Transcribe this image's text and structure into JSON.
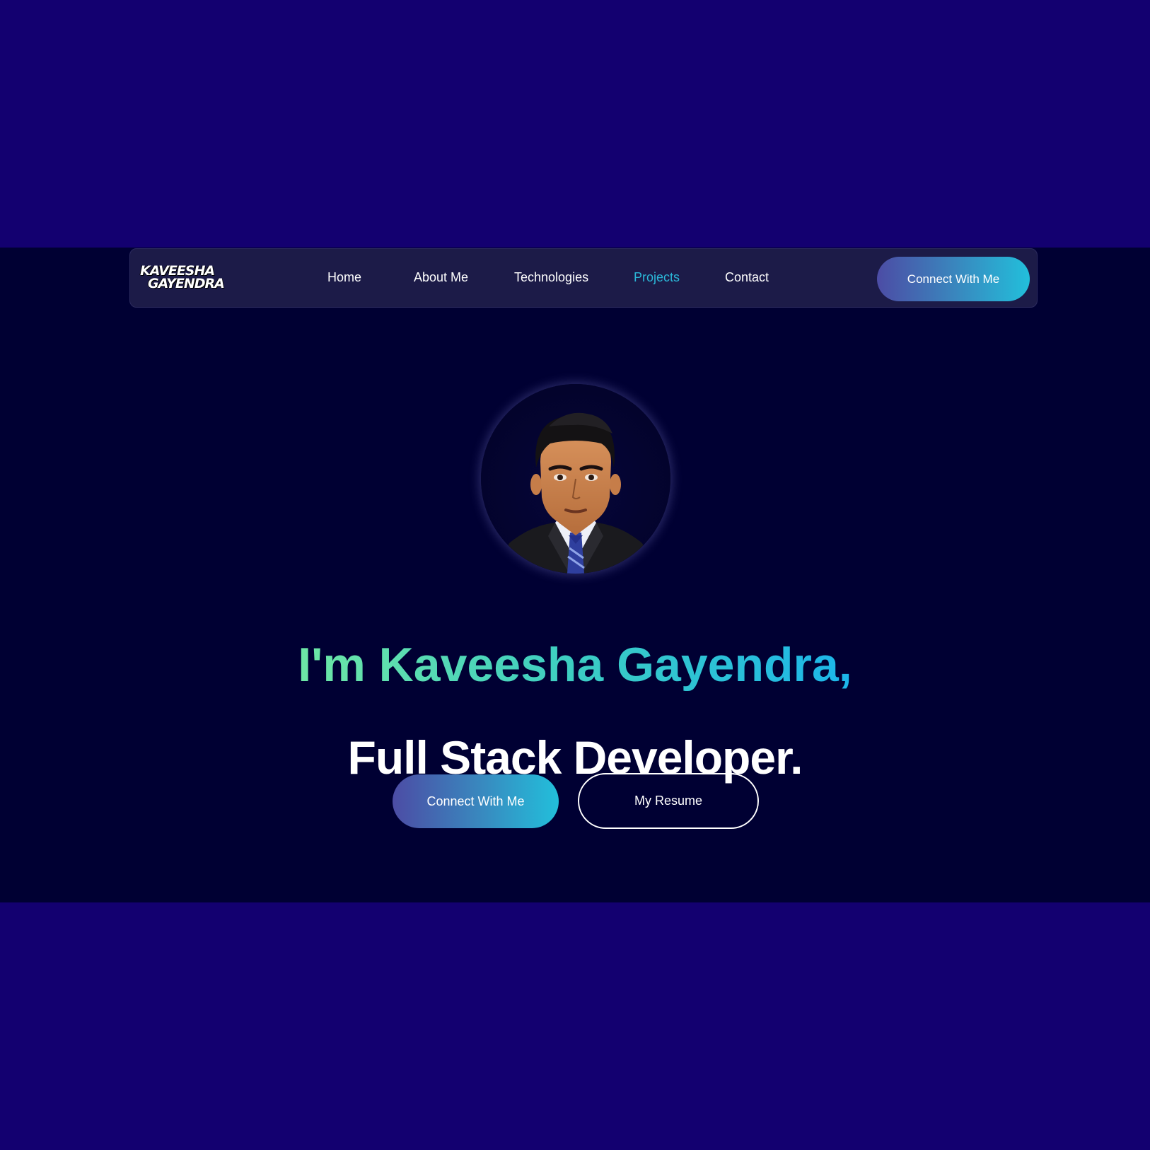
{
  "logo": {
    "line1": "KAVEESHA",
    "line2": "GAYENDRA"
  },
  "nav": {
    "items": [
      {
        "label": "Home",
        "active": false
      },
      {
        "label": "About Me",
        "active": false
      },
      {
        "label": "Technologies",
        "active": false
      },
      {
        "label": "Projects",
        "active": true
      },
      {
        "label": "Contact",
        "active": false
      }
    ],
    "cta_label": "Connect With Me"
  },
  "hero": {
    "avatar_alt": "profile-photo",
    "title": "I'm Kaveesha Gayendra,",
    "subtitle": "Full Stack Developer.",
    "primary_button": "Connect With Me",
    "secondary_button": "My Resume"
  },
  "colors": {
    "outer_background": "#130070",
    "page_background": "#000033",
    "navbar_background": "#1c1b48",
    "active_link": "#2bb8d8",
    "gradient_start": "#4c4ca5",
    "gradient_end": "#22bfdb",
    "title_gradient_start": "#6ee7a5",
    "title_gradient_end": "#1cb6ea"
  }
}
